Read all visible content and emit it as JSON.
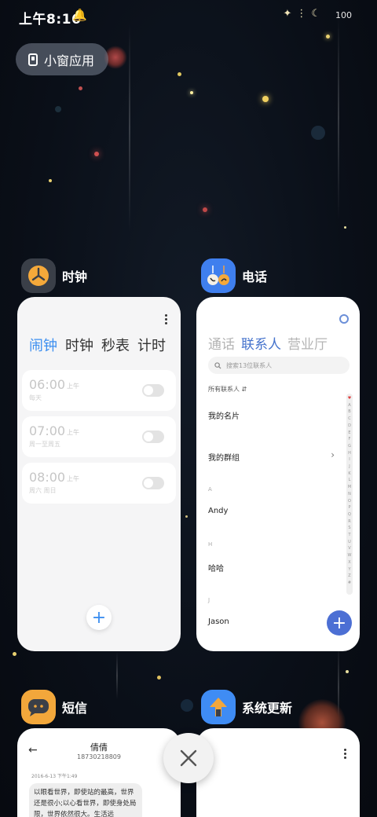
{
  "status_bar": {
    "time": "上午8:16",
    "battery": "100"
  },
  "floating_window": {
    "label": "小窗应用"
  },
  "apps": {
    "clock": {
      "name": "时钟",
      "tabs": [
        "闹钟",
        "时钟",
        "秒表",
        "计时"
      ],
      "alarms": [
        {
          "time": "06:00",
          "ampm": "上午",
          "repeat": "每天"
        },
        {
          "time": "07:00",
          "ampm": "上午",
          "repeat": "周一至周五"
        },
        {
          "time": "08:00",
          "ampm": "上午",
          "repeat": "周六 周日"
        }
      ],
      "add_label": "+"
    },
    "phone": {
      "name": "电话",
      "tabs": [
        "通话",
        "联系人",
        "营业厅"
      ],
      "search_placeholder": "搜索13位联系人",
      "filter": "所有联系人",
      "my_card": "我的名片",
      "my_groups": "我的群组",
      "sections": [
        {
          "letter": "A",
          "contact": "Andy"
        },
        {
          "letter": "H",
          "contact": "哈哈"
        },
        {
          "letter": "J",
          "contact": "Jason"
        }
      ],
      "index": [
        "A",
        "B",
        "C",
        "D",
        "E",
        "F",
        "G",
        "H",
        "I",
        "J",
        "K",
        "L",
        "M",
        "N",
        "O",
        "P",
        "Q",
        "R",
        "S",
        "T",
        "U",
        "V",
        "W",
        "X",
        "Y",
        "Z",
        "#"
      ],
      "add_label": "+"
    },
    "sms": {
      "name": "短信",
      "contact_name": "倩倩",
      "contact_number": "18730218809",
      "date": "2016-6-13 下午1:49",
      "message": "以眼看世界，即使站的最高，世界还是很小;以心看世界，即使身处局限，世界依然很大。生活远"
    },
    "update": {
      "name": "系统更新"
    }
  },
  "colors": {
    "accent_blue": "#3d8ff0",
    "phone_blue": "#4472cc",
    "clock_icon_bg": "#3a3f48",
    "sms_icon_bg": "#f2a73b",
    "update_icon_bg": "#3f8cf4"
  }
}
